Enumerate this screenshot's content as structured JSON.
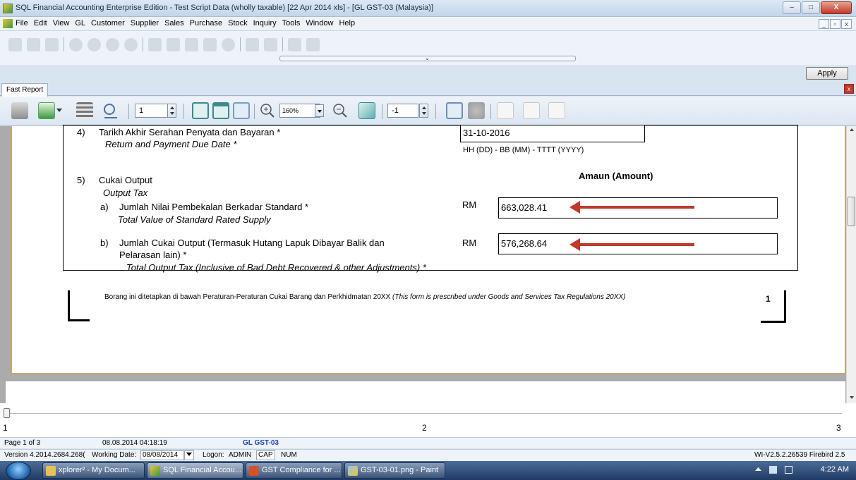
{
  "window": {
    "title": "SQL Financial Accounting Enterprise Edition - Test Script Data (wholly taxable) [22 Apr 2014 xls] - [GL GST-03 (Malaysia)]",
    "min": "–",
    "max": "□",
    "close": "X"
  },
  "menu": {
    "items": [
      "File",
      "Edit",
      "View",
      "GL",
      "Customer",
      "Supplier",
      "Sales",
      "Purchase",
      "Stock",
      "Inquiry",
      "Tools",
      "Window",
      "Help"
    ],
    "mdi": [
      "_",
      "▫",
      "x"
    ]
  },
  "apply_label": "Apply",
  "tab": {
    "label": "Fast Report",
    "close": "x"
  },
  "report_toolbar": {
    "page_input": "1",
    "zoom": "160%",
    "page2_input": "-1"
  },
  "report": {
    "item4": {
      "num": "4)",
      "label_bm": "Tarikh Akhir Serahan Penyata dan Bayaran *",
      "label_en": "Return and Payment Due Date *",
      "value": "31-10-2016",
      "date_format_1": "HH ",
      "date_format_2": "(DD)",
      "date_format_3": "  -  BB ",
      "date_format_4": "(MM)",
      "date_format_5": "  -  TTTT ",
      "date_format_6": "(YYYY)"
    },
    "item5": {
      "num": "5)",
      "label_bm": "Cukai Output",
      "label_en": "Output Tax",
      "amount_header_bm": "Amaun ",
      "amount_header_en": "(Amount)",
      "a": {
        "letter": "a)",
        "label_bm": "Jumlah Nilai Pembekalan Berkadar Standard *",
        "label_en": "Total Value of Standard Rated Supply",
        "currency": "RM",
        "value": "663,028.41"
      },
      "b": {
        "letter": "b)",
        "label_bm_1": "Jumlah Cukai Output (Termasuk Hutang Lapuk Dibayar Balik dan",
        "label_bm_2": "Pelarasan lain) *",
        "label_en": "Total Output Tax (Inclusive of Bad Debt Recovered & other Adjustments) *",
        "currency": "RM",
        "value": "576,268.64"
      }
    },
    "footer_bm": "Borang ini ditetapkan di bawah Peraturan-Peraturan Cukai Barang dan Perkhidmatan 20XX ",
    "footer_en": "(This form is prescribed under Goods and Services Tax Regulations 20XX)",
    "page_number": "1"
  },
  "pager": {
    "start": "1",
    "mid": "2",
    "end": "3"
  },
  "status": {
    "page": "Page 1 of 3",
    "datetime": "08.08.2014 04:18:19",
    "report_name": "GL GST-03"
  },
  "info": {
    "version": "Version 4.2014.2684.268(",
    "working_date_label": "Working Date:",
    "working_date": "08/08/2014",
    "logon_label": "Logon:",
    "user": "ADMIN",
    "cap": "CAP",
    "num": "NUM",
    "db": "WI-V2.5.2.26539 Firebird 2.5"
  },
  "taskbar": {
    "items": [
      "xplorer² - My Docum...",
      "SQL Financial Accou...",
      "GST Compliance for ...",
      "GST-03-01.png - Paint"
    ],
    "time": "4:22 AM"
  },
  "colors": {
    "arrow": "#c0392b",
    "page_border": "#c8a86a",
    "report_name": "#1c3fb5"
  }
}
